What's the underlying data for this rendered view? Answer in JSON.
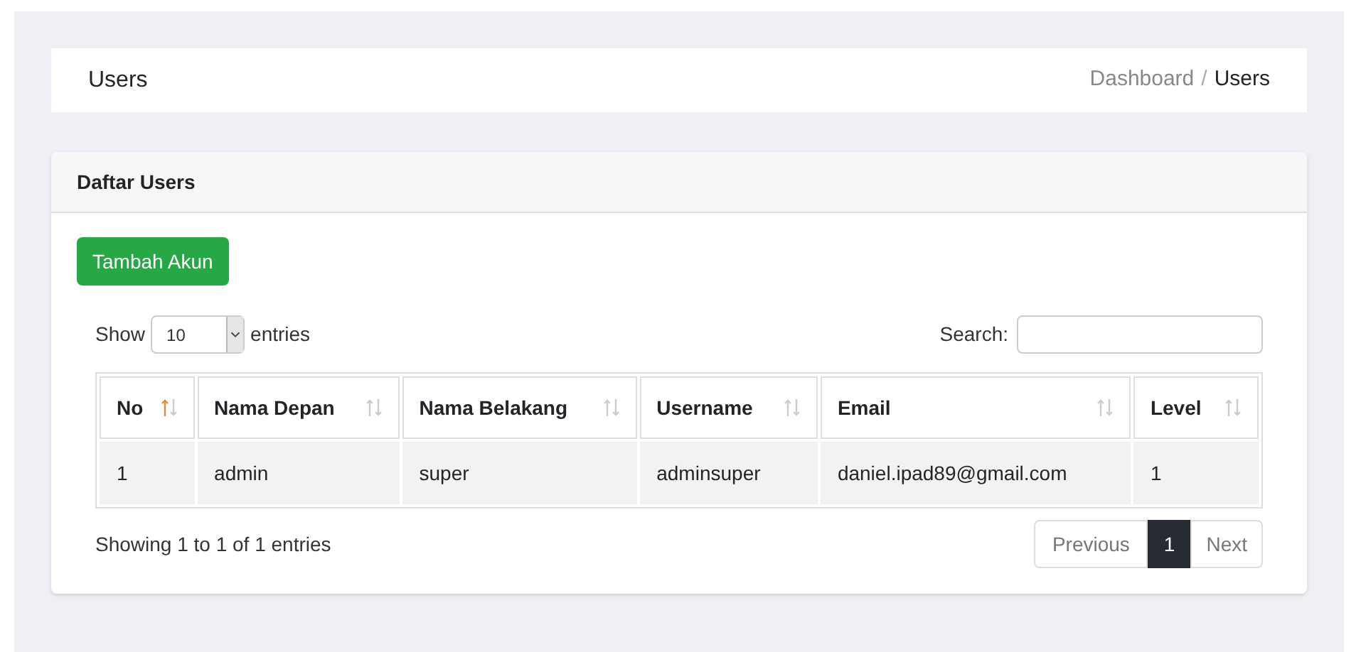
{
  "header": {
    "title": "Users",
    "breadcrumb": [
      {
        "label": "Dashboard",
        "current": false,
        "separator": "/"
      },
      {
        "label": "Users",
        "current": true
      }
    ]
  },
  "card": {
    "title": "Daftar Users",
    "add_button": "Tambah Akun"
  },
  "length": {
    "show_label": "Show",
    "value": "10",
    "entries_label": "entries"
  },
  "search": {
    "label": "Search:"
  },
  "table": {
    "columns": [
      {
        "label": "No",
        "sorted_ascending": true
      },
      {
        "label": "Nama Depan",
        "sorted_ascending": false
      },
      {
        "label": "Nama Belakang",
        "sorted_ascending": false
      },
      {
        "label": "Username",
        "sorted_ascending": false
      },
      {
        "label": "Email",
        "sorted_ascending": false
      },
      {
        "label": "Level",
        "sorted_ascending": false
      }
    ],
    "rows": [
      [
        "1",
        "admin",
        "super",
        "adminsuper",
        "daniel.ipad89@gmail.com",
        "1"
      ]
    ]
  },
  "info": "Showing 1 to 1 of 1 entries",
  "pagination": {
    "previous": "Previous",
    "pages": [
      {
        "label": "1",
        "selected": true
      }
    ],
    "next": "Next"
  }
}
